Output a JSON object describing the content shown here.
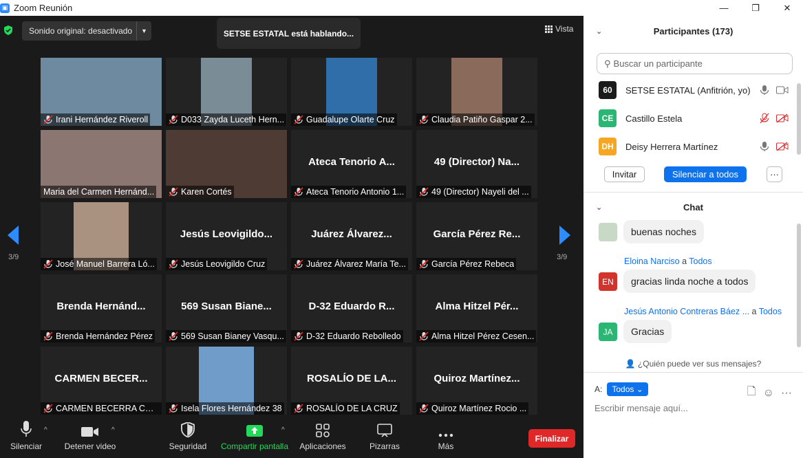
{
  "window": {
    "title": "Zoom Reunión",
    "minimize": "—",
    "maximize": "❐",
    "close": "✕"
  },
  "top": {
    "sound_label": "Sonido original: desactivado",
    "speaking": "SETSE ESTATAL está hablando...",
    "view_label": "Vista"
  },
  "grid": {
    "page_left": "3/9",
    "page_right": "3/9",
    "tiles": [
      {
        "big": "",
        "cap": "Irani Hernández Riveroll",
        "muted": true,
        "video": "#6d8aa0"
      },
      {
        "big": "",
        "cap": "D033 Zayda Luceth Hern...",
        "muted": true,
        "video": "#7a8d97"
      },
      {
        "big": "",
        "cap": "Guadalupe Olarte Cruz",
        "muted": true,
        "video": "#2f6ea8"
      },
      {
        "big": "",
        "cap": "Claudia Patiño Gaspar 2...",
        "muted": true,
        "video": "#8a6a5a"
      },
      {
        "big": "",
        "cap": "Maria del Carmen Hernánd...",
        "muted": false,
        "video": "#8b7671"
      },
      {
        "big": "",
        "cap": "Karen Cortés",
        "muted": true,
        "video": "#4d3b34"
      },
      {
        "big": "Ateca Tenorio A...",
        "cap": "Ateca Tenorio Antonio 1...",
        "muted": true,
        "video": ""
      },
      {
        "big": "49 (Director) Na...",
        "cap": "49 (Director) Nayeli del ...",
        "muted": true,
        "video": ""
      },
      {
        "big": "",
        "cap": "José Manuel Barrera Ló...",
        "muted": true,
        "video": "#a99380"
      },
      {
        "big": "Jesús  Leovigildo...",
        "cap": "Jesús Leovigildo Cruz",
        "muted": true,
        "video": ""
      },
      {
        "big": "Juárez  Álvarez...",
        "cap": "Juárez Álvarez María Te...",
        "muted": true,
        "video": ""
      },
      {
        "big": "García  Pérez  Re...",
        "cap": "García Pérez Rebeca",
        "muted": true,
        "video": ""
      },
      {
        "big": "Brenda  Hernánd...",
        "cap": "Brenda Hernández Pérez",
        "muted": true,
        "video": ""
      },
      {
        "big": "569  Susan  Biane...",
        "cap": "569 Susan Bianey Vasqu...",
        "muted": true,
        "video": ""
      },
      {
        "big": "D-32  Eduardo  R...",
        "cap": "D-32 Eduardo Rebolledo",
        "muted": true,
        "video": ""
      },
      {
        "big": "Alma  Hitzel  Pér...",
        "cap": "Alma Hitzel Pérez Cesen...",
        "muted": true,
        "video": ""
      },
      {
        "big": "CARMEN  BECER...",
        "cap": "CARMEN BECERRA CRU...",
        "muted": true,
        "video": ""
      },
      {
        "big": "",
        "cap": "Isela Flores Hernández 38",
        "muted": true,
        "video": "#6f9cc9"
      },
      {
        "big": "ROSALÍO  DE  LA...",
        "cap": "ROSALÍO DE LA CRUZ",
        "muted": true,
        "video": ""
      },
      {
        "big": "Quiroz  Martínez...",
        "cap": "Quiroz Martínez Rocio ...",
        "muted": true,
        "video": ""
      }
    ]
  },
  "toolbar": {
    "mute": "Silenciar",
    "video": "Detener video",
    "security": "Seguridad",
    "share": "Compartir pantalla",
    "apps": "Aplicaciones",
    "whiteboards": "Pizarras",
    "more": "Más",
    "end": "Finalizar"
  },
  "participants": {
    "title": "Participantes (173)",
    "search_placeholder": "Buscar un participante",
    "list": [
      {
        "initials": "60",
        "name": "SETSE ESTATAL (Anfitrión, yo)",
        "color": "#1b1b1b",
        "muted": false
      },
      {
        "initials": "CE",
        "name": "Castillo Estela",
        "color": "#2bb673",
        "muted": true
      },
      {
        "initials": "DH",
        "name": "Deisy Herrera Martínez",
        "color": "#f5a623",
        "muted": false
      }
    ],
    "invite": "Invitar",
    "mute_all": "Silenciar a todos",
    "more": "···"
  },
  "chat": {
    "title": "Chat",
    "messages": [
      {
        "sender": "",
        "to": "",
        "text": "buenas noches",
        "initials": "",
        "color": "#c8d9c5"
      },
      {
        "sender": "Eloina Narciso",
        "to": "Todos",
        "text": "gracias linda noche a todos",
        "initials": "EN",
        "color": "#d0342c"
      },
      {
        "sender": "Jesús Antonio Contreras Báez ...",
        "to": "Todos",
        "text": "Gracias",
        "initials": "JA",
        "color": "#2bb673"
      }
    ],
    "to_word": "a",
    "who_can_see": "¿Quién puede ver sus mensajes?",
    "to_label": "A:",
    "to_value": "Todos",
    "compose_placeholder": "Escribir mensaje aquí..."
  }
}
